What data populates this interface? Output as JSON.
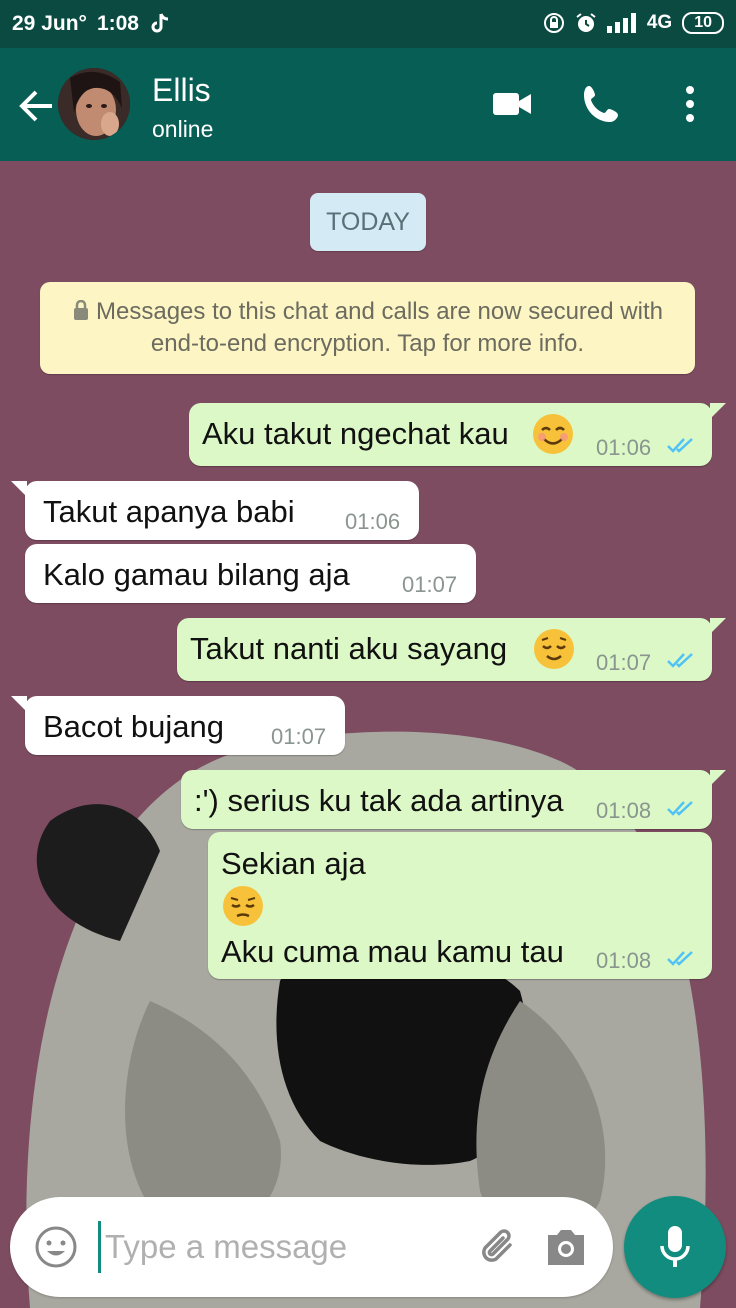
{
  "status_bar": {
    "date": "29 Jun°",
    "time": "1:08",
    "network": "4G",
    "battery": "10"
  },
  "header": {
    "contact_name": "Ellis",
    "contact_status": "online"
  },
  "chat": {
    "date_chip": "TODAY",
    "encryption_notice": "Messages to this chat and calls are now secured with end-to-end encryption. Tap for more info.",
    "messages": [
      {
        "direction": "out",
        "text": "Aku takut ngechat kau",
        "emoji": "smiling-face-emoji",
        "time": "01:06",
        "read": true
      },
      {
        "direction": "in",
        "text": "Takut apanya babi",
        "time": "01:06"
      },
      {
        "direction": "in",
        "text": "Kalo gamau bilang aja",
        "time": "01:07"
      },
      {
        "direction": "out",
        "text": "Takut nanti aku sayang",
        "emoji": "relieved-face-emoji",
        "time": "01:07",
        "read": true
      },
      {
        "direction": "in",
        "text": "Bacot bujang",
        "time": "01:07"
      },
      {
        "direction": "out",
        "text": ":') serius ku tak ada artinya",
        "time": "01:08",
        "read": true
      },
      {
        "direction": "out",
        "line1": "Sekian aja",
        "emoji": "pensive-face-emoji",
        "line3": "Aku cuma mau kamu tau",
        "time": "01:08",
        "read": true
      }
    ]
  },
  "input": {
    "placeholder": "Type a message"
  },
  "colors": {
    "header": "#075e54",
    "status_bar": "#0b4a41",
    "outgoing_bubble": "#dcf8c6",
    "incoming_bubble": "#ffffff",
    "read_ticks": "#4fc3f7",
    "mic_button": "#128c7e"
  }
}
